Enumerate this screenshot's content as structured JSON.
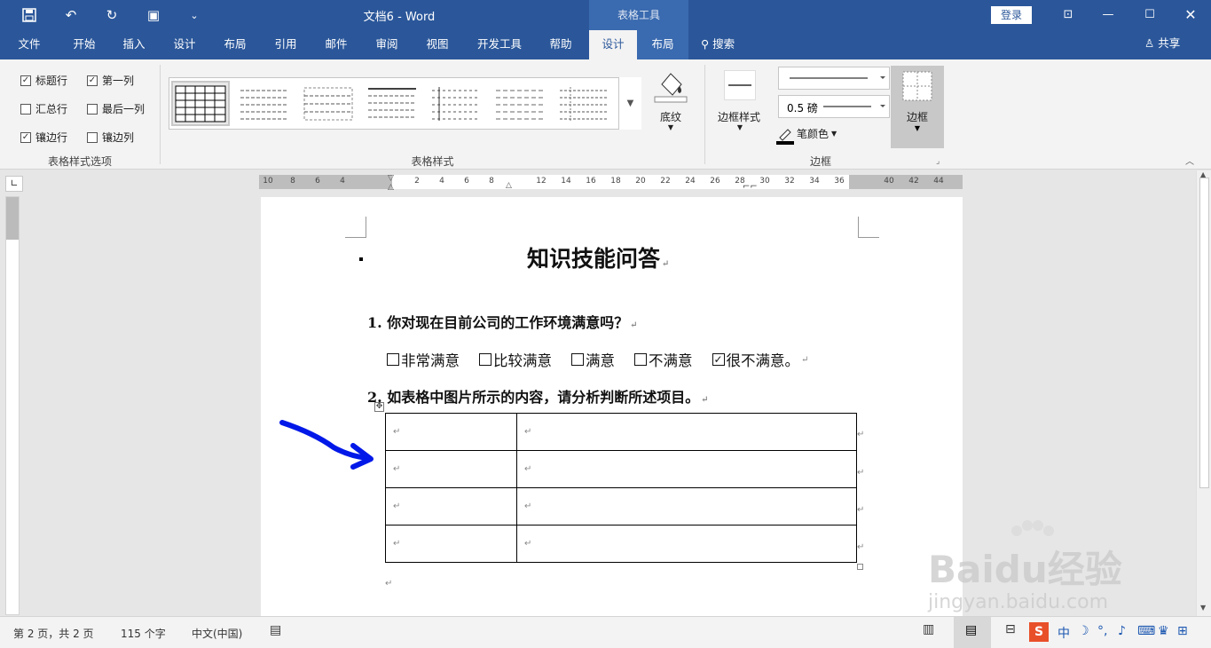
{
  "titlebar": {
    "title": "文档6  -  Word",
    "context_group": "表格工具",
    "login": "登录",
    "icons": [
      "save-icon",
      "undo-icon",
      "redo-icon",
      "touch-mode-icon",
      "customize-icon",
      "ribbon-display-icon",
      "minimize-icon",
      "maximize-icon",
      "close-icon"
    ]
  },
  "tabs": [
    {
      "label": "文件"
    },
    {
      "label": "开始"
    },
    {
      "label": "插入"
    },
    {
      "label": "设计"
    },
    {
      "label": "布局"
    },
    {
      "label": "引用"
    },
    {
      "label": "邮件"
    },
    {
      "label": "审阅"
    },
    {
      "label": "视图"
    },
    {
      "label": "开发工具"
    },
    {
      "label": "帮助"
    },
    {
      "label": "设计"
    },
    {
      "label": "布局"
    }
  ],
  "search": "搜索",
  "share": "共享",
  "ribbon": {
    "style_options": {
      "header_row": "标题行",
      "first_column": "第一列",
      "total_row": "汇总行",
      "last_column": "最后一列",
      "banded_rows": "镶边行",
      "banded_columns": "镶边列",
      "group_label": "表格样式选项",
      "checked": {
        "header_row": true,
        "first_column": true,
        "total_row": false,
        "last_column": false,
        "banded_rows": true,
        "banded_columns": false
      }
    },
    "table_styles": {
      "group_label": "表格样式"
    },
    "shading": "底纹",
    "border_styles": "边框样式",
    "pen_weight": "0.5 磅",
    "pen_color": "笔颜色",
    "borders": "边框",
    "borders_group": "边框"
  },
  "ruler": {
    "h_numbers": [
      "10",
      "8",
      "6",
      "4",
      "2",
      "4",
      "6",
      "8",
      "12",
      "14",
      "16",
      "18",
      "20",
      "22",
      "24",
      "26",
      "28",
      "30",
      "32",
      "34",
      "36",
      "40",
      "42",
      "44"
    ]
  },
  "document": {
    "heading": "知识技能问答",
    "q1": "1. 你对现在目前公司的工作环境满意吗？",
    "choices": [
      {
        "label": "非常满意",
        "checked": false
      },
      {
        "label": "比较满意",
        "checked": false
      },
      {
        "label": "满意",
        "checked": false
      },
      {
        "label": "不满意",
        "checked": false
      },
      {
        "label": "很不满意。",
        "checked": true
      }
    ],
    "q2": "2. 如表格中图片所示的内容，请分析判断所述项目。",
    "table_rows": 4,
    "para_mark": "↵"
  },
  "statusbar": {
    "page": "第 2 页，共 2 页",
    "words": "115 个字",
    "language": "中文(中国)"
  },
  "watermark": {
    "brand": "Baidu经验",
    "url": "jingyan.baidu.com"
  },
  "colors": {
    "accent": "#2b579a",
    "arrow": "#0018e8"
  }
}
